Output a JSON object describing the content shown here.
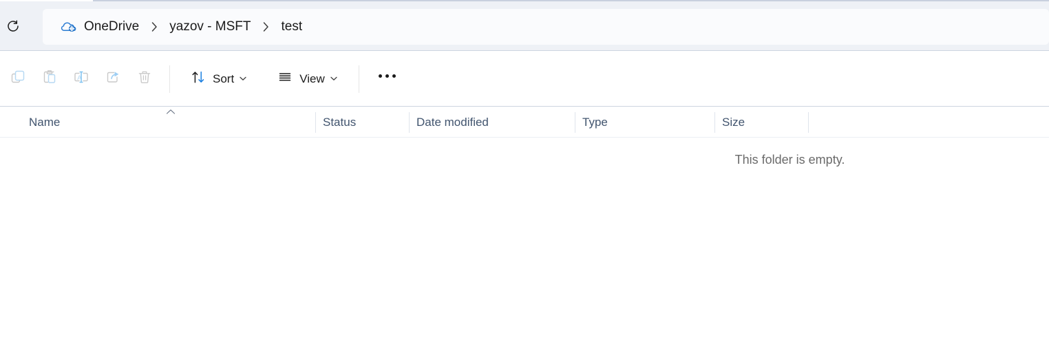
{
  "window": {
    "app": "File Explorer"
  },
  "navbar": {
    "refresh_icon": "refresh-icon",
    "breadcrumbs": [
      {
        "label": "OneDrive",
        "icon": "onedrive-cloud-icon"
      },
      {
        "label": "yazov - MSFT",
        "icon": ""
      },
      {
        "label": "test",
        "icon": ""
      }
    ],
    "separator_icon": "chevron-right-icon"
  },
  "toolbar": {
    "icon_buttons": [
      {
        "name": "copy-button",
        "icon": "copy-icon",
        "enabled": false
      },
      {
        "name": "paste-button",
        "icon": "paste-icon",
        "enabled": false
      },
      {
        "name": "rename-button",
        "icon": "rename-icon",
        "enabled": false
      },
      {
        "name": "share-button",
        "icon": "share-icon",
        "enabled": false
      },
      {
        "name": "delete-button",
        "icon": "trash-icon",
        "enabled": false
      }
    ],
    "sort": {
      "label": "Sort",
      "icon": "sort-arrows-icon",
      "chevron": "chevron-down-icon"
    },
    "view": {
      "label": "View",
      "icon": "list-lines-icon",
      "chevron": "chevron-down-icon"
    },
    "overflow": {
      "label": "...",
      "icon": "ellipsis-icon"
    }
  },
  "columns": [
    {
      "label": "Name",
      "sorted": "ascending",
      "sort_icon": "chevron-up-icon"
    },
    {
      "label": "Status",
      "sorted": ""
    },
    {
      "label": "Date modified",
      "sorted": ""
    },
    {
      "label": "Type",
      "sorted": ""
    },
    {
      "label": "Size",
      "sorted": ""
    }
  ],
  "content": {
    "empty_message": "This folder is empty.",
    "items": []
  },
  "colors": {
    "navbar_background": "#eef1f6",
    "addressbar_background": "#fafbfd",
    "border": "#ccd4e0",
    "accent_blue": "#0f6cbd",
    "disabled_icon": "#c8c8c8",
    "disabled_icon_blue": "#b9d9f2",
    "header_text": "#41546e",
    "empty_text": "#6a6a6a"
  }
}
